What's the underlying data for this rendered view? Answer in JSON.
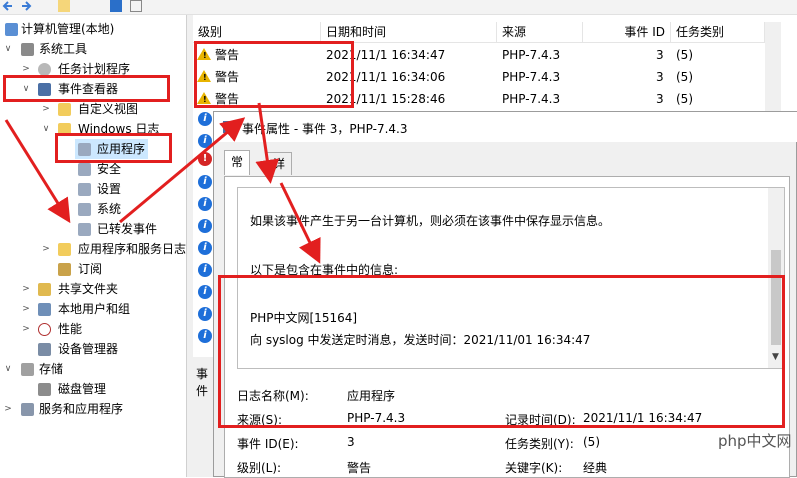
{
  "tree": {
    "items": [
      {
        "label": "计算机管理(本地)",
        "icon": "computer-icon"
      },
      {
        "label": "系统工具",
        "icon": "tools-icon"
      },
      {
        "label": "任务计划程序",
        "icon": "clock-icon"
      },
      {
        "label": "事件查看器",
        "icon": "event-viewer-icon"
      },
      {
        "label": "自定义视图",
        "icon": "folder-icon"
      },
      {
        "label": "Windows 日志",
        "icon": "folder-icon"
      },
      {
        "label": "应用程序",
        "icon": "log-icon"
      },
      {
        "label": "安全",
        "icon": "log-icon"
      },
      {
        "label": "设置",
        "icon": "log-icon"
      },
      {
        "label": "系统",
        "icon": "log-icon"
      },
      {
        "label": "已转发事件",
        "icon": "log-icon"
      },
      {
        "label": "应用程序和服务日志",
        "icon": "folder-icon"
      },
      {
        "label": "订阅",
        "icon": "subscription-icon"
      },
      {
        "label": "共享文件夹",
        "icon": "shared-folder-icon"
      },
      {
        "label": "本地用户和组",
        "icon": "users-icon"
      },
      {
        "label": "性能",
        "icon": "performance-icon"
      },
      {
        "label": "设备管理器",
        "icon": "device-manager-icon"
      },
      {
        "label": "存储",
        "icon": "storage-icon"
      },
      {
        "label": "磁盘管理",
        "icon": "disk-icon"
      },
      {
        "label": "服务和应用程序",
        "icon": "services-icon"
      }
    ]
  },
  "events": {
    "columns": [
      "级别",
      "日期和时间",
      "来源",
      "事件 ID",
      "任务类别"
    ],
    "rows": [
      {
        "level": "警告",
        "datetime": "2021/11/1 16:34:47",
        "source": "PHP-7.4.3",
        "id": "3",
        "category": "(5)"
      },
      {
        "level": "警告",
        "datetime": "2021/11/1 16:34:06",
        "source": "PHP-7.4.3",
        "id": "3",
        "category": "(5)"
      },
      {
        "level": "警告",
        "datetime": "2021/11/1 15:28:46",
        "source": "PHP-7.4.3",
        "id": "3",
        "category": "(5)"
      }
    ],
    "lower_label": "事件"
  },
  "dialog": {
    "title": "事件属性 - 事件 3，PHP-7.4.3",
    "tabs": [
      "常规",
      "详细信息"
    ],
    "message": {
      "line1": "如果该事件产生于另一台计算机，则必须在该事件中保存显示信息。",
      "line2": "以下是包含在事件中的信息:",
      "line3": "PHP中文网[15164]",
      "line4": "向 syslog 中发送定时消息，发送时间：2021/11/01 16:34:47"
    },
    "fields": {
      "log_name_label": "日志名称(M):",
      "log_name_value": "应用程序",
      "source_label": "来源(S):",
      "source_value": "PHP-7.4.3",
      "logged_label": "记录时间(D):",
      "logged_value": "2021/11/1 16:34:47",
      "event_id_label": "事件 ID(E):",
      "event_id_value": "3",
      "task_label": "任务类别(Y):",
      "task_value": "(5)",
      "level_label": "级别(L):",
      "level_value": "警告",
      "keywords_label": "关键字(K):",
      "keywords_value": "经典"
    }
  },
  "watermark": "php中文网",
  "colors": {
    "annotation": "#e21f1f",
    "selection": "#cce8ff",
    "warning": "#e8b400",
    "info": "#1e6fd9"
  }
}
